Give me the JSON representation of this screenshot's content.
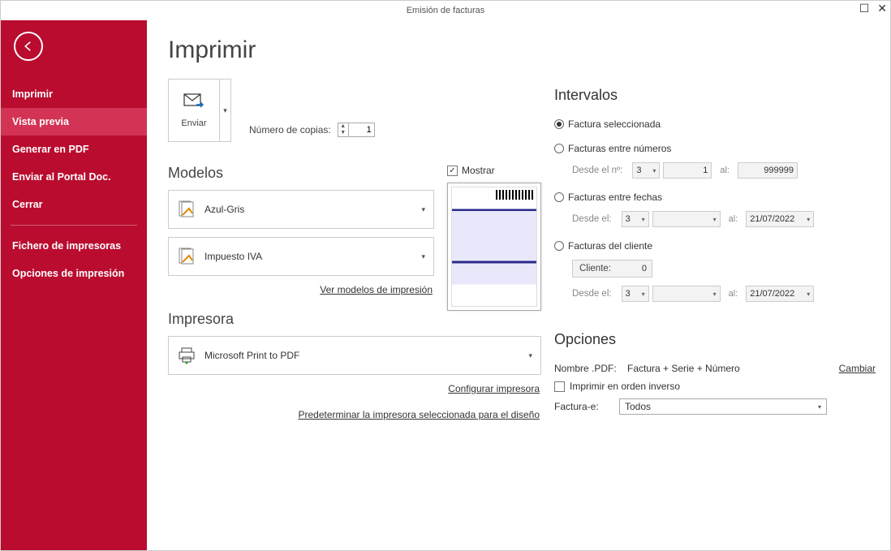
{
  "window": {
    "title": "Emisión de facturas"
  },
  "sidebar": {
    "items": [
      {
        "label": "Imprimir"
      },
      {
        "label": "Vista previa"
      },
      {
        "label": "Generar en PDF"
      },
      {
        "label": "Enviar al Portal Doc."
      },
      {
        "label": "Cerrar"
      },
      {
        "label": "Fichero de impresoras"
      },
      {
        "label": "Opciones de impresión"
      }
    ]
  },
  "page": {
    "title": "Imprimir",
    "send_label": "Enviar",
    "copies_label": "Número de copias:",
    "copies_value": "1"
  },
  "models": {
    "title": "Modelos",
    "model1": "Azul-Gris",
    "model2": "Impuesto IVA",
    "show_label": "Mostrar",
    "link": "Ver modelos de impresión"
  },
  "printer": {
    "title": "Impresora",
    "name": "Microsoft Print to PDF",
    "config_link": "Configurar impresora",
    "default_link": "Predeterminar la impresora seleccionada para el diseño"
  },
  "intervals": {
    "title": "Intervalos",
    "opt_selected": "Factura seleccionada",
    "opt_between_nums": "Facturas entre números",
    "from_num_label": "Desde el nº:",
    "from_num_serie": "3",
    "from_num_value": "1",
    "to_label": "al:",
    "to_num_value": "999999",
    "opt_between_dates": "Facturas entre fechas",
    "from_date_label": "Desde el:",
    "date_serie": "3",
    "date_to_value": "21/07/2022",
    "opt_client": "Facturas del cliente",
    "client_label": "Cliente:",
    "client_value": "0",
    "client_from_label": "Desde el:",
    "client_date_to": "21/07/2022"
  },
  "options": {
    "title": "Opciones",
    "pdf_label": "Nombre .PDF:",
    "pdf_value": "Factura + Serie + Número",
    "change_label": "Cambiar",
    "reverse_label": "Imprimir en orden inverso",
    "facte_label": "Factura-e:",
    "facte_value": "Todos"
  }
}
